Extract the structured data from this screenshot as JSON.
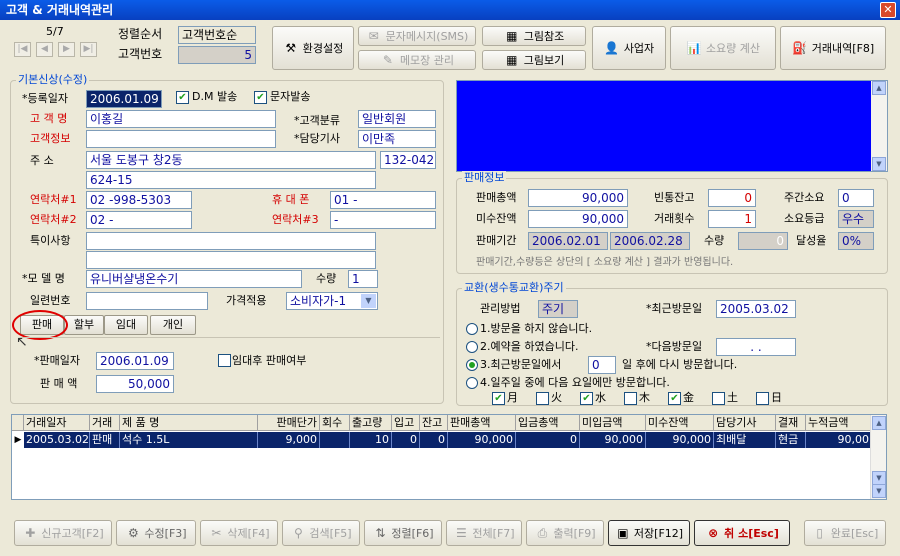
{
  "window": {
    "title": "고객 & 거래내역관리",
    "close_glyph": "✕"
  },
  "nav": {
    "record": "5/7",
    "sort_label": "정렬순서",
    "sort_value": "고객번호순",
    "custno_label": "고객번호",
    "custno_value": "5",
    "first": "|◀",
    "prev": "◀",
    "next": "▶",
    "last": "▶|"
  },
  "toolbar": {
    "env": "환경설정",
    "sms": "문자메시지(SMS)",
    "memo": "메모장 관리",
    "pic_ref": "그림참조",
    "pic_view": "그림보기",
    "business": "사업자",
    "consumption": "소요량 계산",
    "trade_history": "거래내역[F8]"
  },
  "basic": {
    "legend": "기본신상(수정)",
    "regdate_label": "*등록일자",
    "regdate": "2006.01.09",
    "dm_label": "D.M 발송",
    "sms_label": "문자발송",
    "name_label": "고 객 명",
    "name": "이홍길",
    "category_label": "*고객분류",
    "category": "일반회원",
    "info_label": "고객정보",
    "info": "",
    "tech_label": "*담당기사",
    "tech": "이만족",
    "addr_label": "주      소",
    "addr1": "서울 도봉구 창2동",
    "zip": "132-042",
    "addr2": "624-15",
    "contact1_label": "연락처#1",
    "contact1": "02  -998-5303",
    "mobile_label": "휴 대 폰",
    "mobile": "01 -",
    "contact2_label": "연락처#2",
    "contact2": "02  -",
    "contact3_label": "연락처#3",
    "contact3": "-",
    "special_label": "특이사항",
    "special1": "",
    "special2": "",
    "model_label": "*모 델 명",
    "model": "유니버샬냉온수기",
    "qty_label": "수량",
    "qty": "1",
    "serial_label": "일련번호",
    "serial": "",
    "price_label": "가격적용",
    "price": "소비자가-1",
    "tabs": [
      "판매",
      "할부",
      "임대",
      "개인"
    ],
    "saledate_label": "*판매일자",
    "saledate": "2006.01.09",
    "rental_label": "임대후 판매여부",
    "amount_label": "판 매 액",
    "amount": "50,000"
  },
  "sales": {
    "legend": "판매정보",
    "total_label": "판매총액",
    "total": "90,000",
    "empty_label": "빈통잔고",
    "empty": "0",
    "weekly_label": "주간소요",
    "weekly": "0",
    "unpaid_label": "미수잔액",
    "unpaid": "90,000",
    "count_label": "거래횟수",
    "count": "1",
    "grade_label": "소요등급",
    "grade": "우수",
    "period_label": "판매기간",
    "period_from": "2006.02.01",
    "period_to": "2006.02.28",
    "amount_label": "수량",
    "amount": "0",
    "rate_label": "달성율",
    "rate": "0%",
    "note": "판매기간,수량등은 상단의 [ 소요량 계산 ] 결과가 반영됩니다."
  },
  "exchange": {
    "legend": "교환(생수통교환)주기",
    "method_label": "관리방법",
    "method": "주기",
    "lastvisit_label": "*최근방문일",
    "lastvisit": "2005.03.02",
    "opt1": "1.방문을 하지 않습니다.",
    "opt2": "2.예약을 하였습니다.",
    "nextvisit_label": "*다음방문일",
    "nextvisit": ".   .",
    "opt3a": "3.최근방문일에서",
    "days": "0",
    "opt3b": "일 후에 다시 방문합니다.",
    "opt4": "4.일주일 중에 다음 요일에만 방문합니다.",
    "days_of_week": [
      "月",
      "火",
      "水",
      "木",
      "金",
      "土",
      "日"
    ]
  },
  "grid": {
    "headers": [
      "거래일자",
      "거래",
      "제 품 명",
      "판매단가",
      "회수",
      "출고량",
      "입고",
      "잔고",
      "판매총액",
      "입금총액",
      "미입금액",
      "미수잔액",
      "담당기사",
      "결재",
      "누적금액"
    ],
    "row": [
      "2005.03.02",
      "판매",
      "석수 1.5L",
      "9,000",
      "",
      "10",
      "0",
      "0",
      "90,000",
      "0",
      "90,000",
      "90,000",
      "최배달",
      "현금",
      "90,00"
    ],
    "row_marker": "▶"
  },
  "bottom": {
    "new": "신규고객[F2]",
    "edit": "수정[F3]",
    "delete": "삭제[F4]",
    "search": "검색[F5]",
    "sort": "정렬[F6]",
    "all": "전체[F7]",
    "print": "출력[F9]",
    "save": "저장[F12]",
    "cancel": "취 소[Esc]",
    "done": "완료[Esc]"
  },
  "colors": {
    "title": "#0A5CE8",
    "selection": "#0A246A",
    "info_panel": "#0000FF",
    "required": "#D40000",
    "highlight_circle": "#E00000"
  }
}
